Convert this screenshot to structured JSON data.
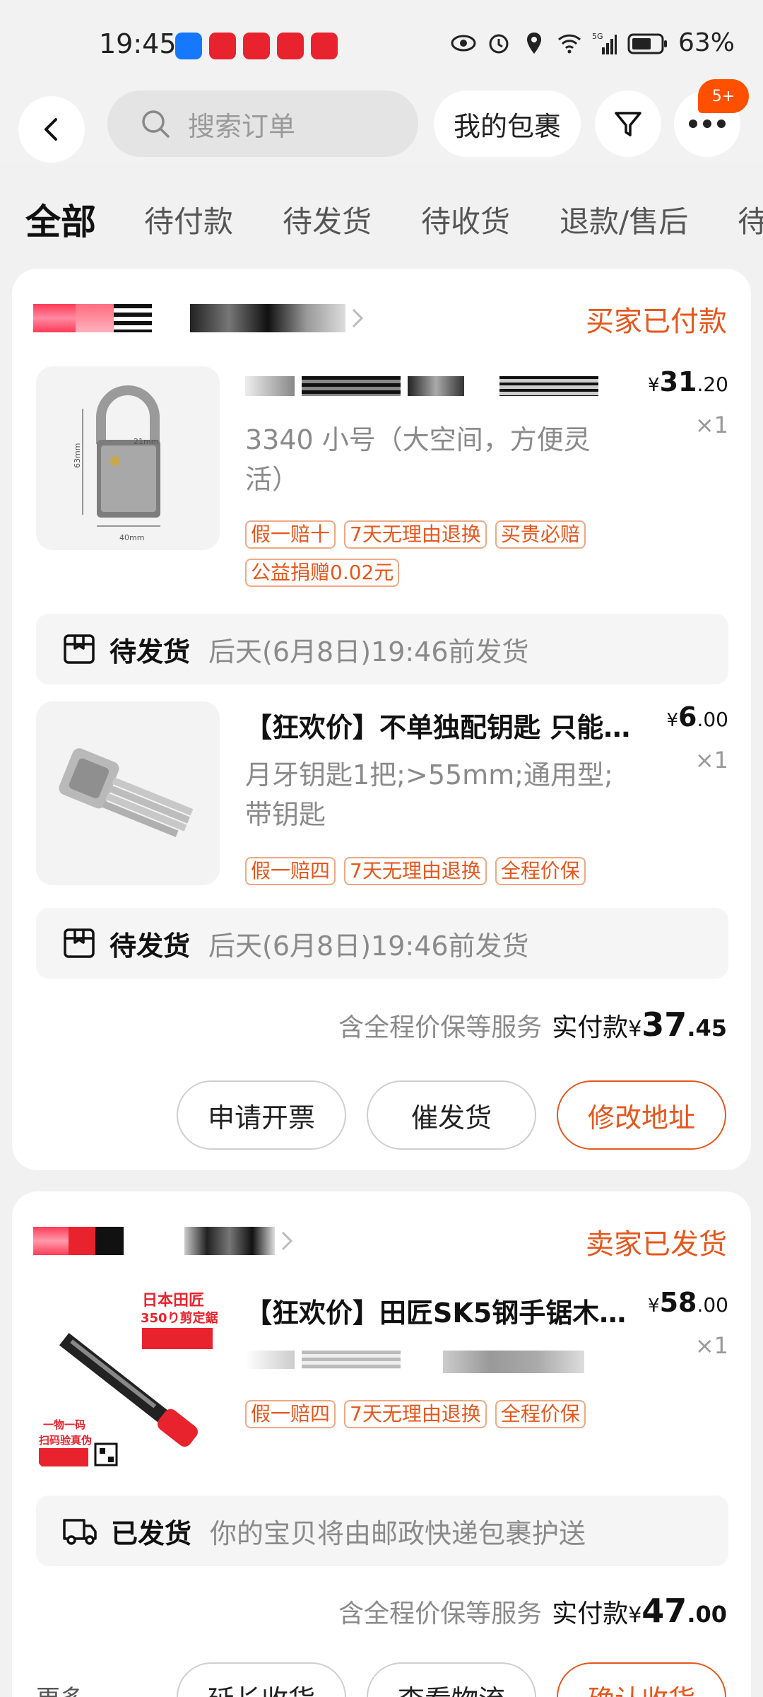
{
  "status_bar": {
    "time": "19:45",
    "battery": "63%",
    "network": "5G"
  },
  "header": {
    "search_placeholder": "搜索订单",
    "package_button": "我的包裹",
    "more_badge": "5+"
  },
  "tabs": [
    "全部",
    "待付款",
    "待发货",
    "待收货",
    "退款/售后",
    "待"
  ],
  "orders": [
    {
      "status": "买家已付款",
      "items": [
        {
          "title": "",
          "spec": "3340 小号（大空间，方便灵活）",
          "price_int": "31",
          "price_dec": ".20",
          "qty": "×1",
          "tags": [
            "假一赔十",
            "7天无理由退换",
            "买贵必赔",
            "公益捐赠0.02元"
          ],
          "image_labels": [
            "63mm",
            "21mm",
            "40mm"
          ],
          "ship_label": "待发货",
          "ship_text": "后天(6月8日)19:46前发货"
        },
        {
          "title": "【狂欢价】不单独配钥匙  只能…",
          "spec": "月牙钥匙1把;>55mm;通用型;带钥匙",
          "price_int": "6",
          "price_dec": ".00",
          "qty": "×1",
          "tags": [
            "假一赔四",
            "7天无理由退换",
            "全程价保"
          ],
          "ship_label": "待发货",
          "ship_text": "后天(6月8日)19:46前发货"
        }
      ],
      "service_note": "含全程价保等服务",
      "paid_label": "实付款",
      "paid_int": "37",
      "paid_dec": ".45",
      "actions": [
        "申请开票",
        "催发货",
        "修改地址"
      ]
    },
    {
      "status": "卖家已发货",
      "items": [
        {
          "title": "【狂欢价】田匠SK5钢手锯木…",
          "spec": "",
          "price_int": "58",
          "price_dec": ".00",
          "qty": "×1",
          "tags": [
            "假一赔四",
            "7天无理由退换",
            "全程价保"
          ],
          "image_labels": [
            "日本田匠",
            "350り剪定鋸",
            "一物一码",
            "扫码验真伪"
          ],
          "ship_label": "已发货",
          "ship_text": "你的宝贝将由邮政快递包裹护送"
        }
      ],
      "service_note": "含全程价保等服务",
      "paid_label": "实付款",
      "paid_int": "47",
      "paid_dec": ".00",
      "more_label": "更多",
      "actions": [
        "延长收货",
        "查看物流",
        "确认收货"
      ]
    }
  ],
  "currency": "¥",
  "colors": {
    "accent": "#e5571d",
    "badge": "#ff5000",
    "background": "#f1f1f1"
  }
}
